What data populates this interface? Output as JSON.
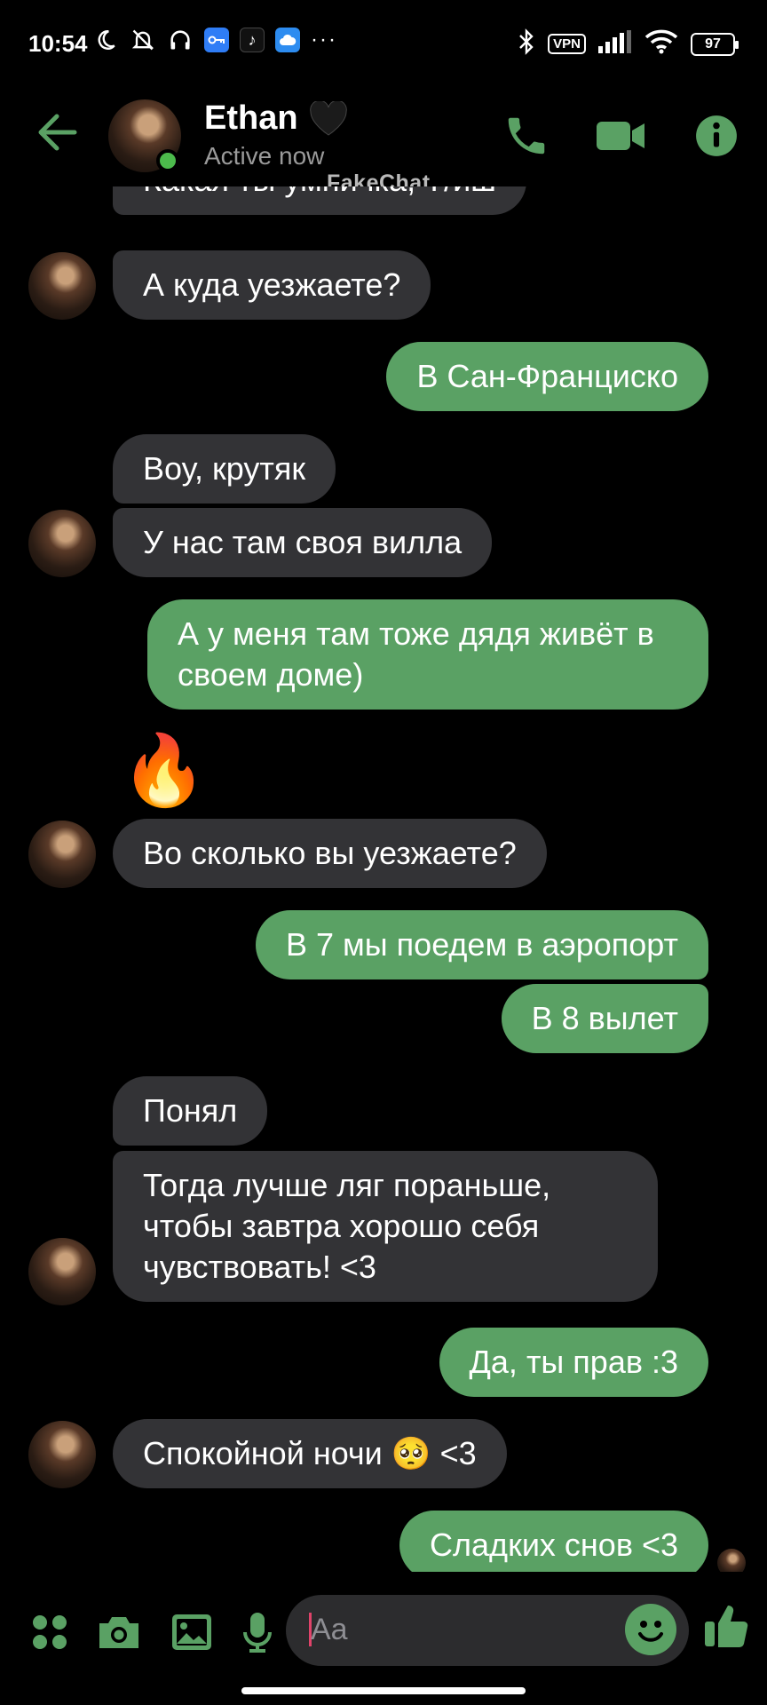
{
  "status_bar": {
    "time": "10:54",
    "vpn": "VPN",
    "battery": "97",
    "more": "···"
  },
  "header": {
    "contact_name": "Ethan",
    "contact_status": "Active now",
    "watermark": "FakeChat",
    "accent_color": "#5aa164"
  },
  "messages": [
    {
      "dir": "in",
      "text": "Какая ты умничка, Т/иш"
    },
    {
      "dir": "in",
      "text": "А куда уезжаете?"
    },
    {
      "dir": "out",
      "text": "В Сан-Франциско"
    },
    {
      "dir": "in",
      "text": "Воу, крутяк"
    },
    {
      "dir": "in",
      "text": "У нас там своя вилла"
    },
    {
      "dir": "out",
      "text": "А у меня там тоже дядя живёт в своем доме)"
    },
    {
      "dir": "out",
      "text": "🔥",
      "type": "reaction"
    },
    {
      "dir": "in",
      "text": "Во сколько вы уезжаете?"
    },
    {
      "dir": "out",
      "text": "В 7 мы поедем в аэропорт"
    },
    {
      "dir": "out",
      "text": "В 8 вылет"
    },
    {
      "dir": "in",
      "text": "Понял"
    },
    {
      "dir": "in",
      "text": "Тогда лучше ляг пораньше, чтобы завтра хорошо себя чувствовать! <3"
    },
    {
      "dir": "out",
      "text": "Да, ты прав :3"
    },
    {
      "dir": "in",
      "text": "Спокойной ночи 🥺 <3"
    },
    {
      "dir": "out",
      "text": "Сладких снов <3"
    }
  ],
  "composer": {
    "placeholder": "Aa"
  }
}
